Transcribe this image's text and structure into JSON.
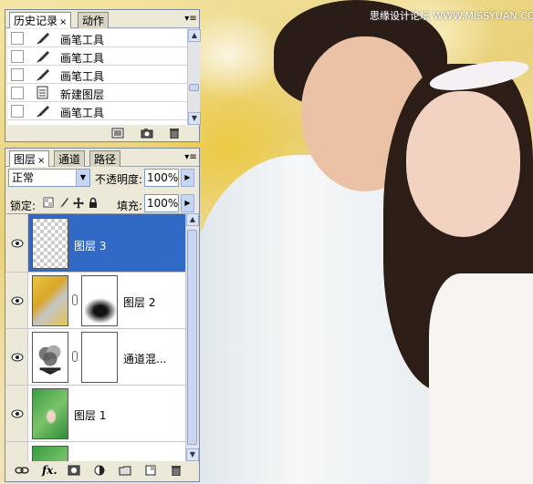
{
  "watermark": "思缘设计论坛 WWW.MISSYUAN.COM",
  "history_panel": {
    "tabs": [
      {
        "label": "历史记录",
        "close": "×"
      },
      {
        "label": "动作"
      }
    ],
    "menu_icon": "▾≡",
    "items": [
      {
        "icon": "brush-icon",
        "label": "画笔工具"
      },
      {
        "icon": "brush-icon",
        "label": "画笔工具"
      },
      {
        "icon": "brush-icon",
        "label": "画笔工具"
      },
      {
        "icon": "new-layer-icon",
        "label": "新建图层"
      },
      {
        "icon": "brush-icon",
        "label": "画笔工具"
      }
    ]
  },
  "layers_panel": {
    "tabs": [
      {
        "label": "图层",
        "close": "×"
      },
      {
        "label": "通道"
      },
      {
        "label": "路径"
      }
    ],
    "menu_icon": "▾≡",
    "blend_mode": "正常",
    "opacity_label": "不透明度:",
    "opacity_value": "100%",
    "lock_label": "锁定:",
    "fill_label": "填充:",
    "fill_value": "100%",
    "layers": [
      {
        "name": "图层 3",
        "selected": true
      },
      {
        "name": "图层 2",
        "selected": false
      },
      {
        "name": "通道混...",
        "selected": false
      },
      {
        "name": "图层 1",
        "selected": false
      }
    ],
    "footer_fx": "fx."
  },
  "colors": {
    "selection": "#3169c6",
    "panel_bg": "#ece9d8",
    "scroll_blue": "#c6d5f4"
  }
}
